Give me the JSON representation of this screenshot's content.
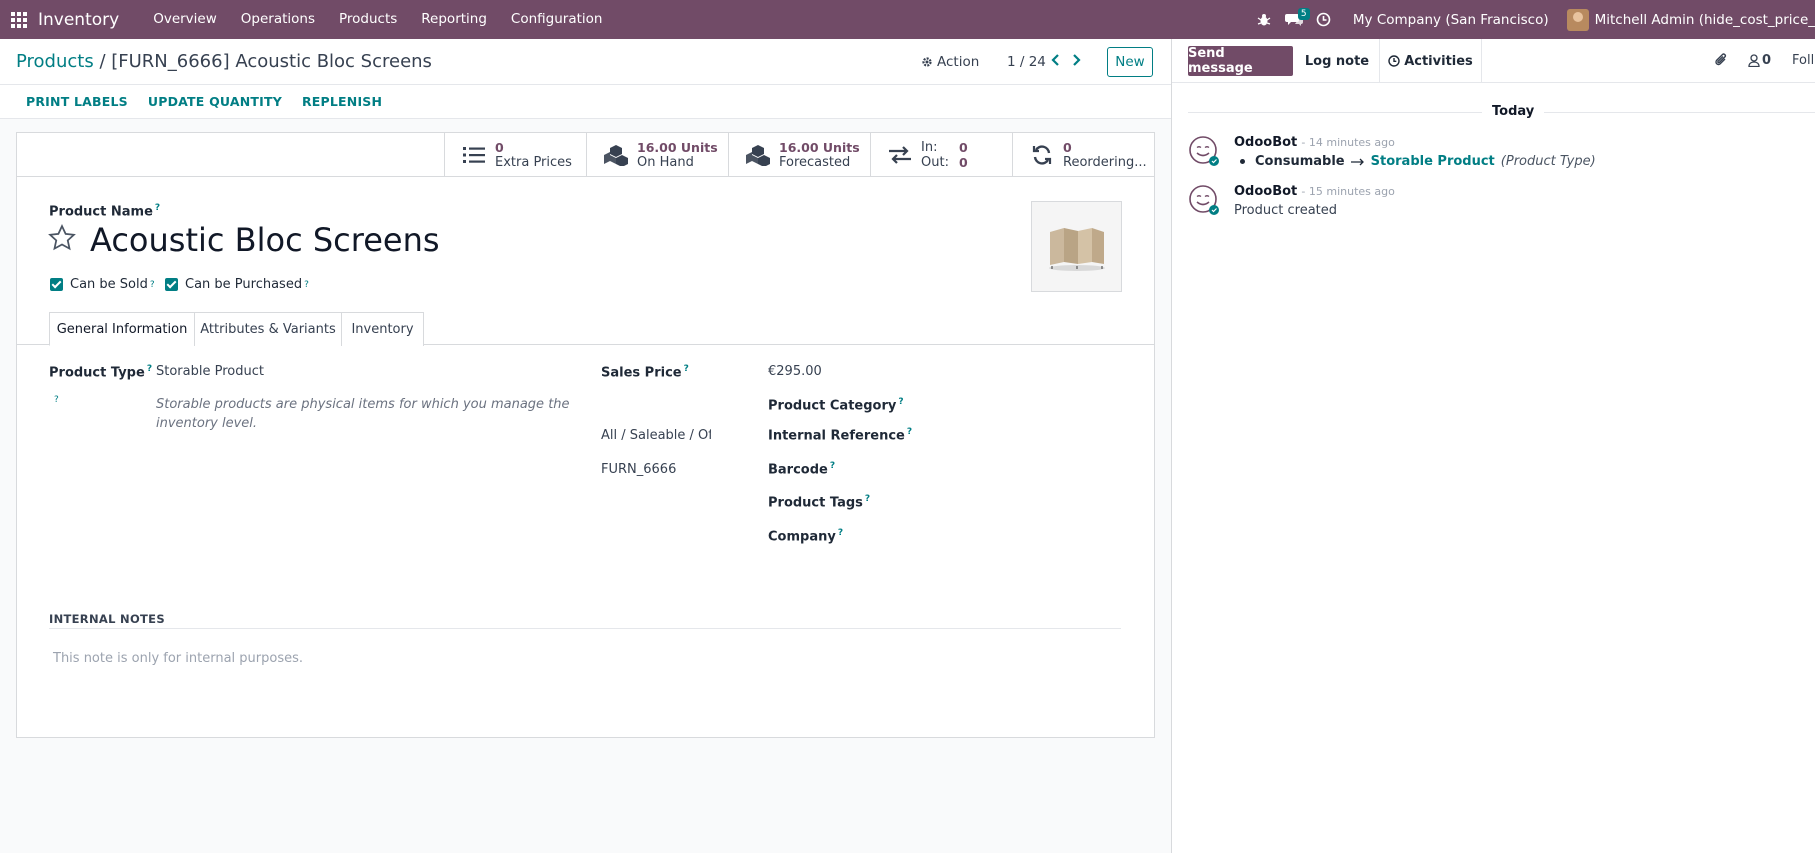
{
  "navbar": {
    "app_name": "Inventory",
    "menu": [
      "Overview",
      "Operations",
      "Products",
      "Reporting",
      "Configuration"
    ],
    "messages_count": "5",
    "company": "My Company (San Francisco)",
    "user": "Mitchell Admin (hide_cost_price_"
  },
  "control": {
    "breadcrumb_parent": "Products",
    "breadcrumb_sep": " / ",
    "breadcrumb_current": "[FURN_6666] Acoustic Bloc Screens",
    "action_label": "Action",
    "pager": "1 / 24",
    "new_label": "New"
  },
  "header_buttons": [
    "PRINT LABELS",
    "UPDATE QUANTITY",
    "REPLENISH"
  ],
  "stats": {
    "extra_prices": {
      "value": "0",
      "label": "Extra Prices"
    },
    "on_hand": {
      "value": "16.00 Units",
      "label": "On Hand"
    },
    "forecasted": {
      "value": "16.00 Units",
      "label": "Forecasted"
    },
    "in_out": {
      "in_label": "In:",
      "in_value": "0",
      "out_label": "Out:",
      "out_value": "0"
    },
    "reordering": {
      "value": "0",
      "label": "Reordering..."
    }
  },
  "form": {
    "product_name_label": "Product Name",
    "product_name": "Acoustic Bloc Screens",
    "can_be_sold": "Can be Sold",
    "can_be_purchased": "Can be Purchased",
    "tabs": [
      "General Information",
      "Attributes & Variants",
      "Inventory"
    ],
    "product_type_label": "Product Type",
    "product_type": "Storable Product",
    "product_type_help": "Storable products are physical items for which you manage the inventory level.",
    "sales_price_label": "Sales Price",
    "sales_price": "€295.00",
    "product_category_label": "Product Category",
    "product_category": "All / Saleable / Off",
    "internal_reference_label": "Internal Reference",
    "internal_reference": "FURN_6666",
    "barcode_label": "Barcode",
    "product_tags_label": "Product Tags",
    "company_label": "Company",
    "internal_notes_label": "INTERNAL NOTES",
    "internal_notes_placeholder": "This note is only for internal purposes."
  },
  "chatter": {
    "send_message": "Send message",
    "log_note": "Log note",
    "activities": "Activities",
    "followers_count": "0",
    "follow_label": "Follo",
    "date_separator": "Today",
    "messages": [
      {
        "author": "OdooBot",
        "time": "- 14 minutes ago",
        "old_value": "Consumable",
        "new_value": "Storable Product",
        "field": "(Product Type)"
      },
      {
        "author": "OdooBot",
        "time": "- 15 minutes ago",
        "body": "Product created"
      }
    ]
  },
  "colors": {
    "brand": "#714b67",
    "accent": "#017e84"
  }
}
